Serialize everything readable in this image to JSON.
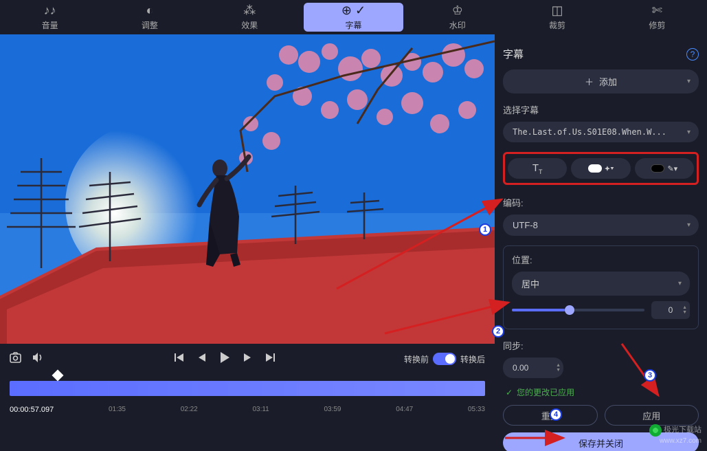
{
  "toolbar": {
    "items": [
      {
        "label": "音量",
        "icon": "♪♪"
      },
      {
        "label": "调整",
        "icon": "◐"
      },
      {
        "label": "效果",
        "icon": "✦"
      },
      {
        "label": "字幕",
        "icon": "💬",
        "active": true
      },
      {
        "label": "水印",
        "icon": "♔"
      },
      {
        "label": "裁剪",
        "icon": "✂"
      },
      {
        "label": "修剪",
        "icon": "✄"
      }
    ]
  },
  "controls": {
    "before": "转换前",
    "after": "转换后"
  },
  "timeline": {
    "current": "00:00:57.097",
    "marks": [
      "01:35",
      "02:22",
      "03:11",
      "03:59",
      "04:47",
      "05:33"
    ]
  },
  "panel": {
    "title": "字幕",
    "add": "添加",
    "select_label": "选择字幕",
    "file": "The.Last.of.Us.S01E08.When.W...",
    "encoding_label": "编码:",
    "encoding": "UTF-8",
    "position_label": "位置:",
    "position": "居中",
    "position_value": "0",
    "sync_label": "同步:",
    "sync_value": "0.00",
    "status": "您的更改已应用",
    "reset": "重置",
    "apply": "应用",
    "save_close": "保存并关闭"
  },
  "watermark": {
    "line1": "极光下载站",
    "line2": "www.xz7.com"
  }
}
